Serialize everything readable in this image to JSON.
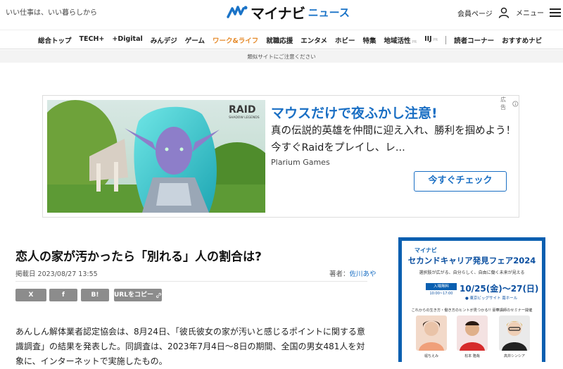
{
  "header": {
    "tagline": "いい仕事は、いい暮らしから",
    "logo_main": "マイナビ",
    "logo_sub": "ニュース",
    "member_label": "会員ページ",
    "menu_label": "メニュー"
  },
  "nav": {
    "items": [
      {
        "label": "総合トップ",
        "sup": ""
      },
      {
        "label": "TECH+",
        "sup": ""
      },
      {
        "label": "+Digital",
        "sup": ""
      },
      {
        "label": "みんデジ",
        "sup": ""
      },
      {
        "label": "ゲーム",
        "sup": ""
      },
      {
        "label": "ワーク&ライフ",
        "sup": ""
      },
      {
        "label": "就職応援",
        "sup": ""
      },
      {
        "label": "エンタメ",
        "sup": ""
      },
      {
        "label": "ホビー",
        "sup": ""
      },
      {
        "label": "特集",
        "sup": ""
      },
      {
        "label": "地域活性",
        "sup": "PR"
      },
      {
        "label": "IIJ",
        "sup": "PR"
      }
    ],
    "items_right": [
      {
        "label": "読者コーナー"
      },
      {
        "label": "おすすめナビ"
      }
    ],
    "active_index": 5,
    "active_color": "#e58a2a"
  },
  "notice": "類似サイトにご注意ください",
  "ad": {
    "badge": "広告",
    "image_logo": "RAID",
    "image_logo_sub": "SHADOW LEGENDS",
    "title": "マウスだけで夜ふかし注意!",
    "body": "真の伝説的英雄を仲間に迎え入れ、勝利を掴めよう！今すぐRaidをプレイし、レ...",
    "source": "Plarium Games",
    "cta": "今すぐチェック",
    "accent": "#1a6fc4"
  },
  "article": {
    "title": "恋人の家が汚かったら「別れる」人の割合は?",
    "date": "掲載日 2023/08/27 13:55",
    "author_prefix": "著者：",
    "author": "佐川あや",
    "share": {
      "x": "X",
      "facebook": "f",
      "hatena": "B!",
      "copy": "URLをコピー"
    },
    "body": "あんしん解体業者認定協会は、8月24日、「彼氏彼女の家が汚いと感じるポイントに関する意識調査」の結果を発表した。同調査は、2023年7月4日〜8日の期間、全国の男女481人を対象に、インターネットで実施したもの。"
  },
  "side_ad": {
    "brand": "マイナビ",
    "title": "セカンドキャリア発見フェア2024",
    "subtitle": "選択肢が広がる、自分らしく、自由に働く未来が見える",
    "tag": "入場無料",
    "time": "10:00~17:00",
    "date": "10/25(金)〜27(日)",
    "venue": "● 東京ビッグサイト 南ホール",
    "bar": "これからの生き方・働き方のヒントが見つかる!! 豪華講師のセミナー開催",
    "people": [
      "堀ちえみ",
      "松本 隆哉",
      "高井シンシア"
    ],
    "color": "#0a5fb0"
  }
}
